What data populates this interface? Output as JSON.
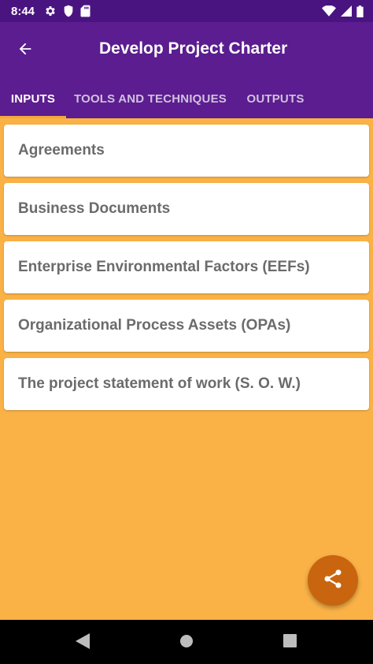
{
  "status_bar": {
    "time": "8:44",
    "left_icons": [
      "gear-icon",
      "shield-icon",
      "sd-card-icon"
    ],
    "right_icons": [
      "wifi-icon",
      "cell-signal-icon",
      "battery-icon"
    ]
  },
  "app_bar": {
    "title": "Develop Project Charter",
    "back_icon": "arrow-left-icon"
  },
  "tabs": [
    {
      "label": "INPUTS",
      "active": true
    },
    {
      "label": "TOOLS AND TECHNIQUES",
      "active": false
    },
    {
      "label": "OUTPUTS",
      "active": false
    }
  ],
  "items": [
    {
      "label": "Agreements"
    },
    {
      "label": "Business Documents"
    },
    {
      "label": "Enterprise Environmental Factors (EEFs)"
    },
    {
      "label": "Organizational Process Assets (OPAs)"
    },
    {
      "label": "The project statement of work (S. O. W.)"
    }
  ],
  "fab": {
    "icon": "share-icon"
  },
  "nav_bar": {
    "icons": [
      "nav-back-icon",
      "nav-home-icon",
      "nav-recents-icon"
    ]
  },
  "colors": {
    "status_bar": "#4A1480",
    "app_bar": "#5B1D8F",
    "background": "#FAB246",
    "tab_indicator": "#F5A640",
    "fab": "#C9650E",
    "item_text": "#6B6B6B"
  }
}
